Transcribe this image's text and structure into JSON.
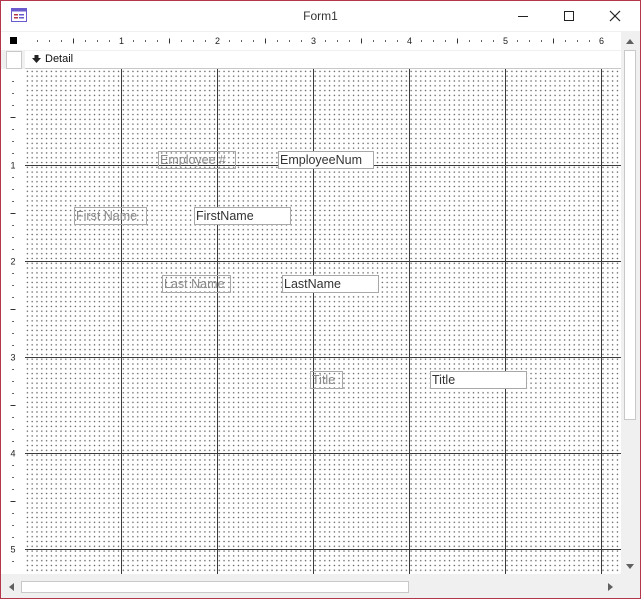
{
  "window": {
    "title": "Form1"
  },
  "icons": {
    "app": "form-icon",
    "minimize": "minimize-icon",
    "maximize": "maximize-icon",
    "close": "close-icon",
    "section": "section-arrow-icon"
  },
  "ruler": {
    "horizontal_labels": [
      "1",
      "2",
      "3",
      "4",
      "5",
      "6"
    ],
    "vertical_labels": [
      "1",
      "2",
      "3",
      "4",
      "5"
    ]
  },
  "section": {
    "label": "Detail"
  },
  "controls": {
    "employee_label": "Employee #",
    "employee_field": "EmployeeNum",
    "firstname_label": "First Name",
    "firstname_field": "FirstName",
    "lastname_label": "Last Name",
    "lastname_field": "LastName",
    "title_label": "Title",
    "title_field": "Title"
  },
  "colors": {
    "window_border": "#b4364a",
    "grid_line": "#3a3a3a"
  }
}
